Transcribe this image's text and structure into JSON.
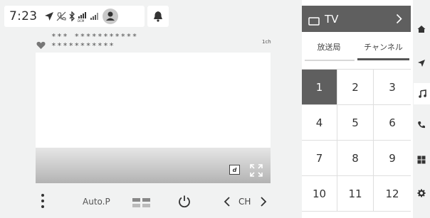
{
  "status": {
    "time": "7:23",
    "icons": [
      "navigation-arrow-icon",
      "phone-off-icon",
      "bluetooth-icon",
      "dcm-signal-icon",
      "cell-signal-icon",
      "user-icon",
      "bell-icon"
    ]
  },
  "program": {
    "title_line1": "*** ***********",
    "title_line2": "***********",
    "channel_badge": "1ch",
    "favorite_icon": "heart-icon"
  },
  "video_controls": {
    "data_button_label": "d",
    "fullscreen_icon": "fullscreen-icon"
  },
  "bottom_bar": {
    "more_icon": "more-vertical-icon",
    "auto_preset_label": "Auto.P",
    "layout_icon": "layout-icon",
    "power_icon": "power-icon",
    "channel_label": "CH"
  },
  "source": {
    "label": "TV",
    "icon": "tv-icon"
  },
  "tabs": [
    {
      "label": "放送局",
      "active": false
    },
    {
      "label": "チャンネル",
      "active": true
    }
  ],
  "keypad": {
    "keys": [
      "1",
      "2",
      "3",
      "4",
      "5",
      "6",
      "7",
      "8",
      "9",
      "10",
      "11",
      "12"
    ],
    "selected": "1"
  },
  "side_nav": [
    {
      "icon": "home-icon",
      "active": false
    },
    {
      "icon": "navigation-icon",
      "active": false
    },
    {
      "icon": "music-icon",
      "active": true
    },
    {
      "icon": "phone-icon",
      "active": false
    },
    {
      "icon": "apps-grid-icon",
      "active": false
    },
    {
      "icon": "settings-icon",
      "active": false
    }
  ],
  "colors": {
    "accent_dark": "#5f5f5f",
    "background": "#f1f2f2",
    "panel": "#ffffff"
  }
}
